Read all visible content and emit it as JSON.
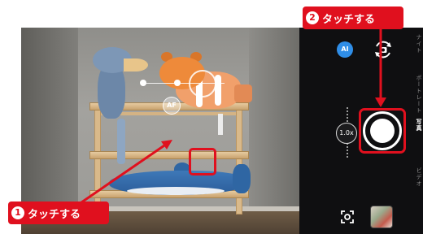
{
  "callouts": {
    "step1": {
      "number": "1",
      "label": "タッチする"
    },
    "step2": {
      "number": "2",
      "label": "タッチする"
    }
  },
  "viewfinder": {
    "af_badge": "AF"
  },
  "controls": {
    "ai_label": "AI",
    "zoom_label": "1.0x"
  },
  "modes": [
    {
      "label": "ナイト",
      "active": false
    },
    {
      "label": "ポートレート",
      "active": false
    },
    {
      "label": "写真",
      "active": true
    },
    {
      "label": "ビデオ",
      "active": false
    }
  ],
  "colors": {
    "callout_red": "#e0101e",
    "panel_bg": "#0f0f11",
    "ai_blue": "#2f8ee8"
  },
  "icons": {
    "switch_camera": "switch-camera-icon",
    "lens": "google-lens-icon",
    "gallery": "gallery-thumbnail"
  }
}
